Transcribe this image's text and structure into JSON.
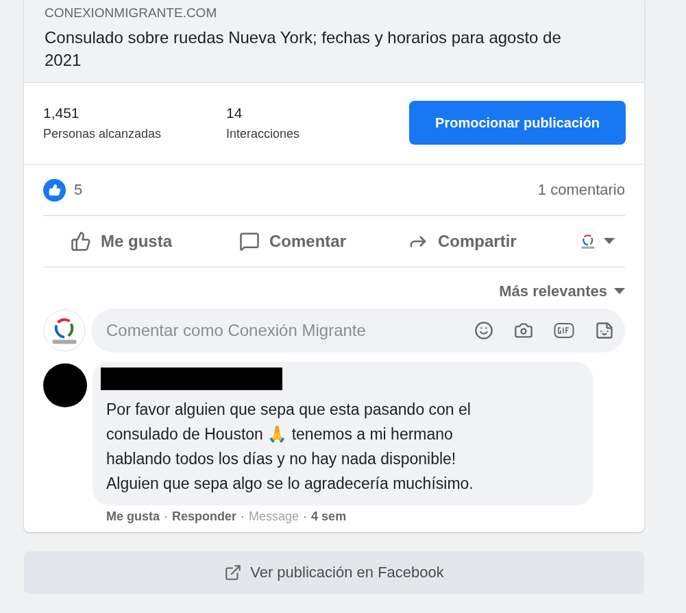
{
  "preview": {
    "domain": "CONEXIONMIGRANTE.COM",
    "title": "Consulado sobre ruedas Nueva York; fechas y horarios para agosto de 2021"
  },
  "stats": [
    {
      "value": "1,451",
      "label": "Personas alcanzadas"
    },
    {
      "value": "14",
      "label": "Interacciones"
    }
  ],
  "promote_button": "Promocionar publicación",
  "reactions": {
    "count": "5",
    "comments": "1 comentario"
  },
  "actions": [
    {
      "kind": "like",
      "label": "Me gusta"
    },
    {
      "kind": "comment",
      "label": "Comentar"
    },
    {
      "kind": "share",
      "label": "Compartir"
    },
    {
      "kind": "page"
    }
  ],
  "sort": {
    "label": "Más relevantes"
  },
  "composer": {
    "placeholder": "Comentar como Conexión Migrante"
  },
  "comment": {
    "text": "Por favor alguien que sepa que esta pasando con el consulado de Houston 🙏 tenemos a mi hermano hablando todos los días y no hay nada disponible! Alguien que sepa algo se lo agradecería muchísimo.",
    "meta": [
      {
        "kind": "link",
        "text": "Me gusta"
      },
      {
        "kind": "separator",
        "text": "·"
      },
      {
        "kind": "link",
        "text": "Responder"
      },
      {
        "kind": "separator",
        "text": "·"
      },
      {
        "kind": "muted",
        "text": "Message"
      },
      {
        "kind": "separator",
        "text": "·"
      },
      {
        "kind": "time",
        "text": "4 sem"
      }
    ]
  },
  "footer_button": "Ver publicación en Facebook"
}
